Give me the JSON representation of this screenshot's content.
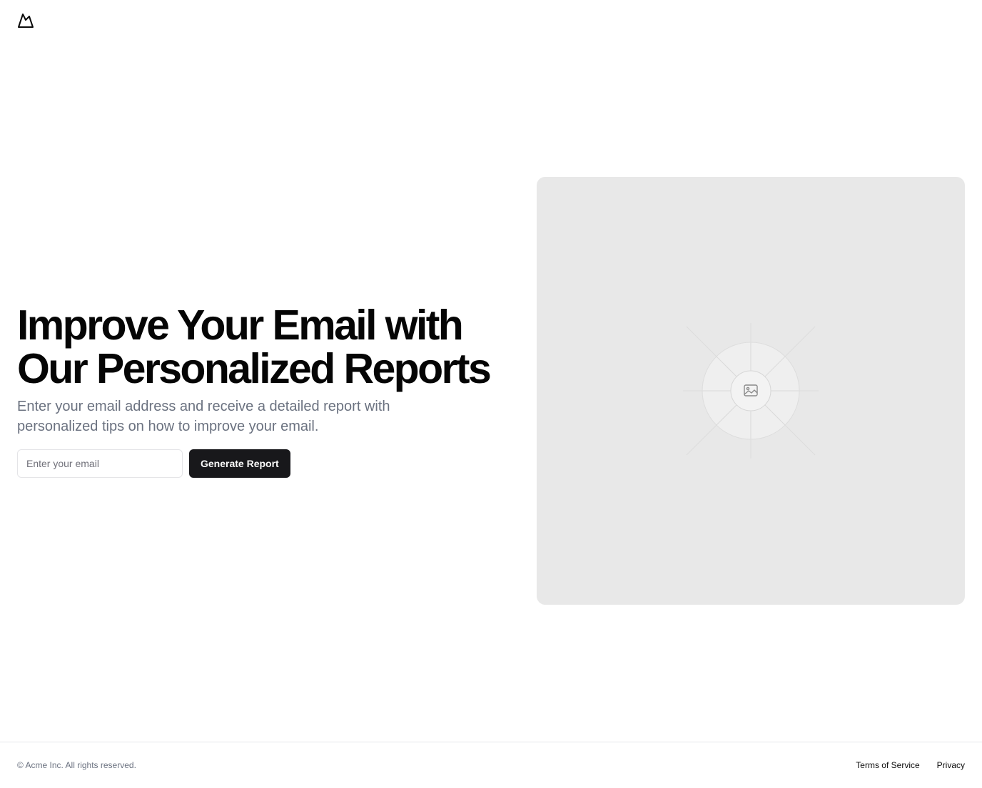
{
  "header": {
    "logo_icon": "mountain-icon"
  },
  "hero": {
    "headline_line1": "Improve Your Email with",
    "headline_line2": "Our Personalized Reports",
    "subtext": "Enter your email address and receive a detailed report with personalized tips on how to improve your email.",
    "email_placeholder": "Enter your email",
    "email_value": "",
    "button_label": "Generate Report",
    "image_icon": "image-placeholder-icon"
  },
  "footer": {
    "copyright": "© Acme Inc. All rights reserved.",
    "links": [
      {
        "label": "Terms of Service"
      },
      {
        "label": "Privacy"
      }
    ]
  },
  "colors": {
    "button_bg": "#18181b",
    "button_text": "#fafafa",
    "muted_text": "#6b7280",
    "placeholder_bg": "#e8e8e8"
  }
}
